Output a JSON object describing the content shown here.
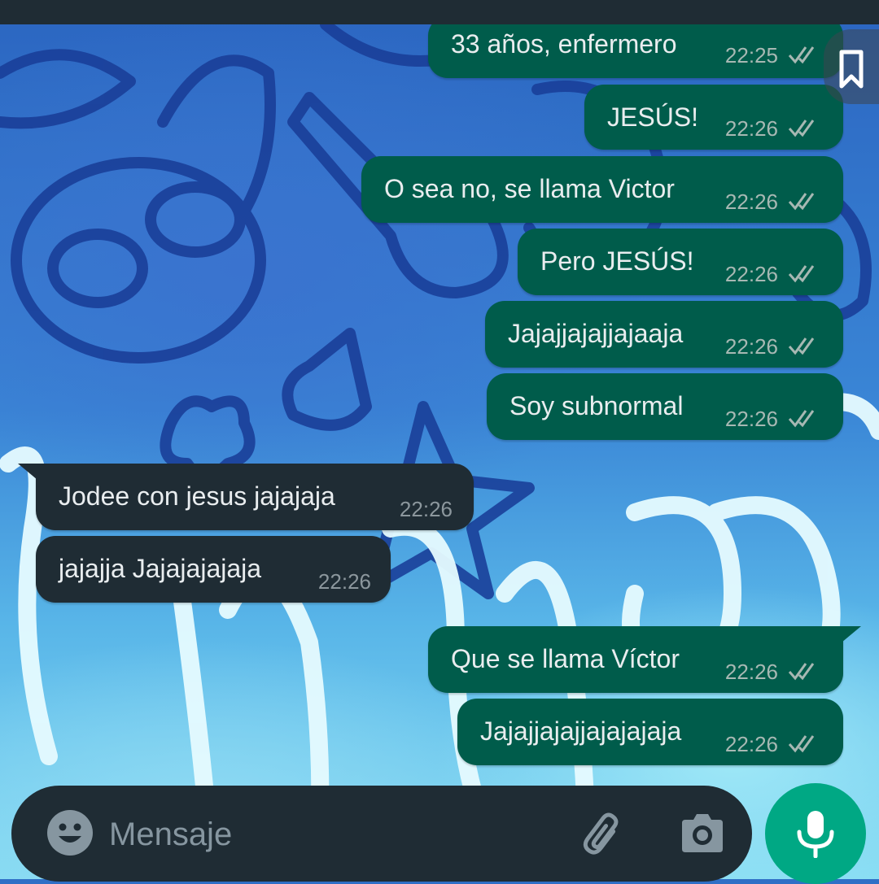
{
  "composer": {
    "placeholder": "Mensaje",
    "emoji_icon": "emoji-smile-icon",
    "attach_icon": "paperclip-icon",
    "camera_icon": "camera-icon"
  },
  "mic": {
    "icon": "microphone-icon"
  },
  "colors": {
    "outgoing_bubble": "#005c4b",
    "incoming_bubble": "#1f2c34",
    "accent": "#00a884",
    "topbar": "#1f2c34"
  },
  "messages": [
    {
      "direction": "out",
      "text": "33 años, enfermero",
      "time": "22:25",
      "status": "read"
    },
    {
      "direction": "out",
      "text": "JESÚS!",
      "time": "22:26",
      "status": "read"
    },
    {
      "direction": "out",
      "text": "O sea no, se llama Victor",
      "time": "22:26",
      "status": "read"
    },
    {
      "direction": "out",
      "text": "Pero JESÚS!",
      "time": "22:26",
      "status": "read"
    },
    {
      "direction": "out",
      "text": "Jajajjajajjajaaja",
      "time": "22:26",
      "status": "read"
    },
    {
      "direction": "out",
      "text": "Soy subnormal",
      "time": "22:26",
      "status": "read"
    },
    {
      "direction": "in",
      "text": "Jodee con jesus jajajaja",
      "time": "22:26"
    },
    {
      "direction": "in",
      "text": "jajajja Jajajajajaja",
      "time": "22:26"
    },
    {
      "direction": "out",
      "text": "Que se llama Víctor",
      "time": "22:26",
      "status": "read"
    },
    {
      "direction": "out",
      "text": "Jajajjajajjajajajaja",
      "time": "22:26",
      "status": "read"
    }
  ]
}
